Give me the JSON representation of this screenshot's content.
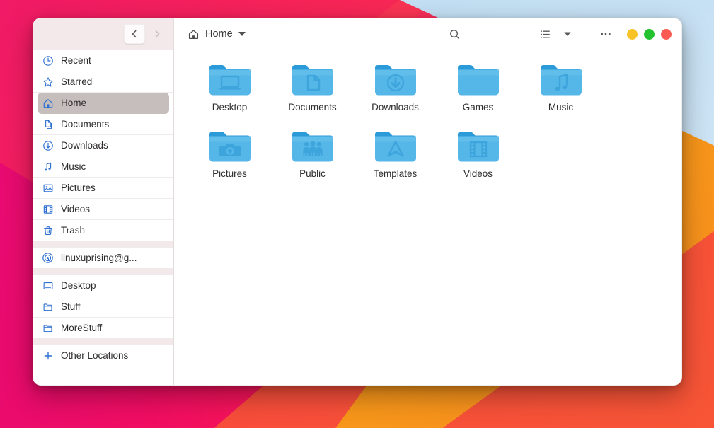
{
  "window": {
    "title": "Home",
    "controls": [
      {
        "name": "minimize",
        "color": "#f7c326"
      },
      {
        "name": "maximize",
        "color": "#22c32e"
      },
      {
        "name": "close",
        "color": "#fa5a51"
      }
    ]
  },
  "navigation": {
    "back_label": "Back",
    "forward_label": "Forward"
  },
  "pathbar": {
    "icon": "home-icon",
    "label": "Home",
    "dropdown": "chevron-down-icon"
  },
  "toolbar": {
    "search_label": "Search",
    "view_list_label": "List view",
    "view_options_label": "View options",
    "menu_label": "Main menu"
  },
  "sidebar": {
    "groups": [
      {
        "items": [
          {
            "label": "Recent",
            "icon": "clock-icon",
            "selected": false
          },
          {
            "label": "Starred",
            "icon": "star-icon",
            "selected": false
          },
          {
            "label": "Home",
            "icon": "home-icon",
            "selected": true
          },
          {
            "label": "Documents",
            "icon": "documents-icon",
            "selected": false
          },
          {
            "label": "Downloads",
            "icon": "download-icon",
            "selected": false
          },
          {
            "label": "Music",
            "icon": "music-note-icon",
            "selected": false
          },
          {
            "label": "Pictures",
            "icon": "image-icon",
            "selected": false
          },
          {
            "label": "Videos",
            "icon": "film-icon",
            "selected": false
          },
          {
            "label": "Trash",
            "icon": "trash-icon",
            "selected": false
          }
        ]
      },
      {
        "items": [
          {
            "label": "linuxuprising@g...",
            "icon": "network-broadcast-icon",
            "selected": false
          }
        ]
      },
      {
        "items": [
          {
            "label": "Desktop",
            "icon": "desktop-folder-icon",
            "selected": false
          },
          {
            "label": "Stuff",
            "icon": "folder-icon",
            "selected": false
          },
          {
            "label": "MoreStuff",
            "icon": "folder-icon",
            "selected": false
          }
        ]
      },
      {
        "items": [
          {
            "label": "Other Locations",
            "icon": "plus-icon",
            "selected": false
          }
        ]
      }
    ]
  },
  "files": [
    {
      "label": "Desktop",
      "emblem": "desktop"
    },
    {
      "label": "Documents",
      "emblem": "document"
    },
    {
      "label": "Downloads",
      "emblem": "download"
    },
    {
      "label": "Games",
      "emblem": "none"
    },
    {
      "label": "Music",
      "emblem": "music"
    },
    {
      "label": "Pictures",
      "emblem": "camera"
    },
    {
      "label": "Public",
      "emblem": "people"
    },
    {
      "label": "Templates",
      "emblem": "templates"
    },
    {
      "label": "Videos",
      "emblem": "film"
    }
  ],
  "colors": {
    "folder_body": "#55b6e8",
    "folder_tab": "#2a9bd8",
    "accent_blue": "#2c6fd1",
    "selection": "#c6bdbd",
    "sidebar_header": "#f3e9ea"
  }
}
